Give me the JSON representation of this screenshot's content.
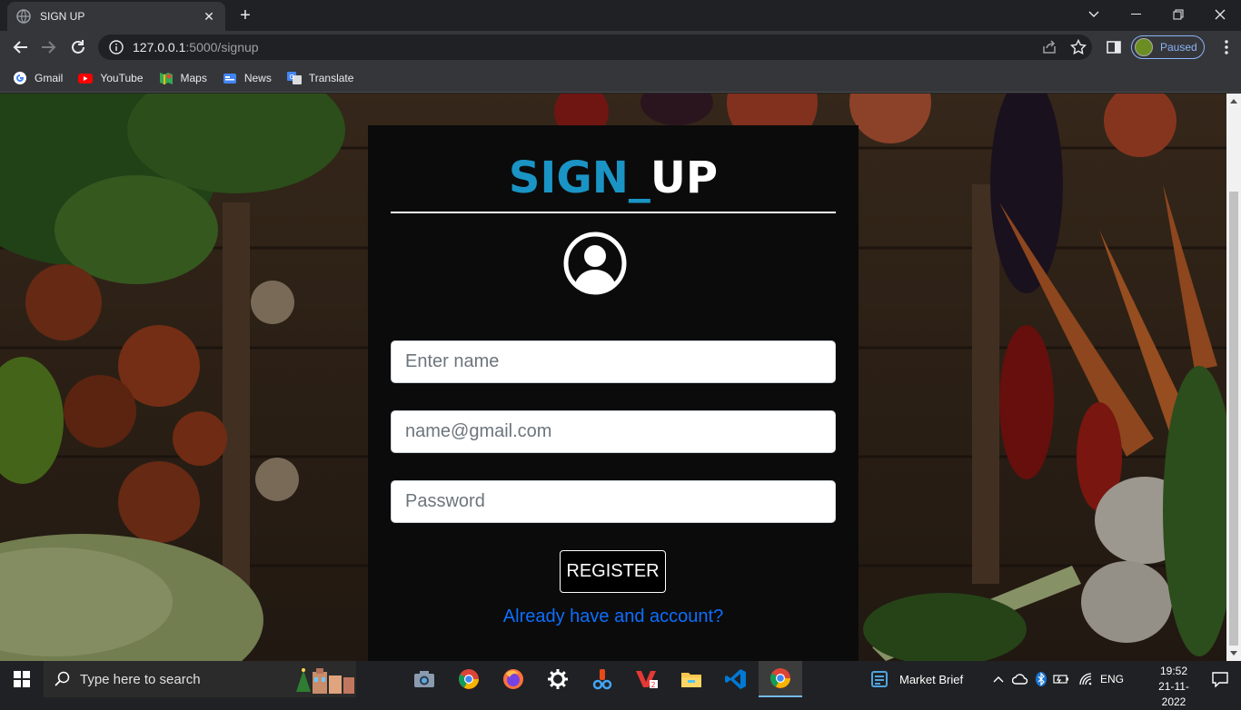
{
  "browser": {
    "tab_title": "SIGN UP",
    "url_host": "127.0.0.1",
    "url_rest": ":5000/signup",
    "profile_label": "Paused",
    "bookmarks": [
      {
        "label": "Gmail",
        "icon": "gmail-icon"
      },
      {
        "label": "YouTube",
        "icon": "youtube-icon"
      },
      {
        "label": "Maps",
        "icon": "maps-icon"
      },
      {
        "label": "News",
        "icon": "news-icon"
      },
      {
        "label": "Translate",
        "icon": "translate-icon"
      }
    ]
  },
  "page": {
    "heading_part1": "SIGN_",
    "heading_part2": "UP",
    "name_placeholder": "Enter name",
    "email_placeholder": "name@gmail.com",
    "password_placeholder": "Password",
    "register_label": "REGISTER",
    "login_link": "Already have and account?"
  },
  "taskbar": {
    "search_placeholder": "Type here to search",
    "widget_label": "Market Brief",
    "language": "ENG",
    "time": "19:52",
    "date": "21-11-2022"
  },
  "colors": {
    "heading_blue": "#1a94c4",
    "link_blue": "#0d6efd",
    "card_bg": "#0b0b0b"
  }
}
